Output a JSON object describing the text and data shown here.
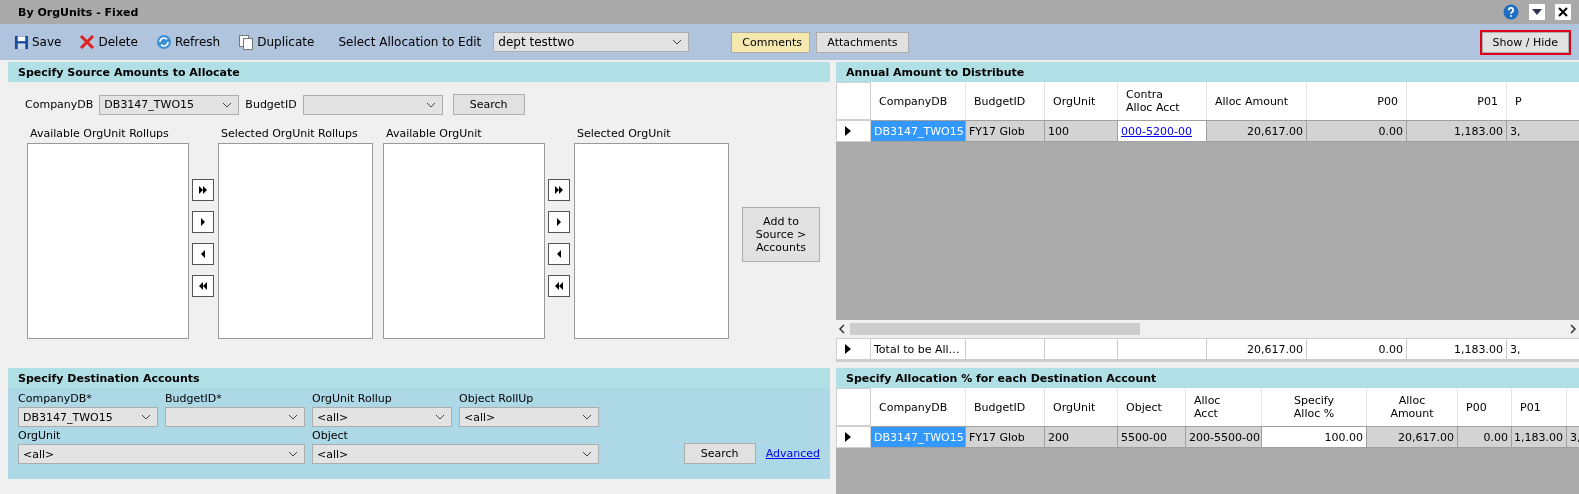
{
  "window": {
    "title": "By OrgUnits - Fixed"
  },
  "toolbar": {
    "buttons": [
      {
        "label": "Save",
        "kind": "save"
      },
      {
        "label": "Delete",
        "kind": "delete"
      },
      {
        "label": "Refresh",
        "kind": "refresh"
      },
      {
        "label": "Duplicate",
        "kind": "duplicate"
      }
    ],
    "allocation_label": "Select Allocation to Edit",
    "allocation_value": "dept testtwo",
    "comments": "Comments",
    "attachments": "Attachments",
    "show_hide": "Show / Hide"
  },
  "source": {
    "title": "Specify Source Amounts to Allocate",
    "company_label": "CompanyDB",
    "company_value": "DB3147_TWO15",
    "budget_label": "BudgetID",
    "search": "Search",
    "lists": [
      "Available OrgUnit Rollups",
      "Selected OrgUnit Rollups",
      "Available OrgUnit",
      "Selected OrgUnit"
    ],
    "add_button": "Add to Source > Accounts"
  },
  "destination": {
    "title": "Specify Destination Accounts",
    "fields": [
      {
        "label": "CompanyDB*",
        "value": "DB3147_TWO15"
      },
      {
        "label": "BudgetID*"
      },
      {
        "label": "OrgUnit Rollup",
        "value": "<all>"
      },
      {
        "label": "Object RollUp",
        "value": "<all>"
      },
      {
        "label": "OrgUnit",
        "value": "<all>"
      },
      {
        "label": "Object",
        "value": "<all>"
      }
    ],
    "search": "Search",
    "advanced": "Advanced"
  },
  "annual_grid": {
    "title": "Annual Amount to Distribute",
    "columns": [
      "CompanyDB",
      "BudgetID",
      "OrgUnit",
      "Contra\nAlloc Acct",
      "Alloc Amount",
      "P00",
      "P01",
      "P"
    ],
    "rows": [
      {
        "cells": [
          {
            "text": "DB3147_TWO15",
            "kind": "current"
          },
          {
            "text": "FY17 Glob",
            "kind": "readonly"
          },
          {
            "text": "100",
            "kind": "readonly"
          },
          {
            "text": "000-5200-00",
            "kind": "link"
          },
          {
            "text": "20,617.00",
            "kind": "readonly_num"
          },
          {
            "text": "0.00",
            "kind": "readonly_num"
          },
          {
            "text": "1,183.00",
            "kind": "readonly_num"
          },
          {
            "text": "3,",
            "kind": "readonly"
          }
        ]
      }
    ],
    "total_row": {
      "label": "Total to be All…",
      "amounts": [
        "20,617.00",
        "0.00",
        "1,183.00",
        "3,"
      ]
    }
  },
  "allocation_grid": {
    "title": "Specify Allocation % for each Destination Account",
    "columns": [
      "CompanyDB",
      "BudgetID",
      "OrgUnit",
      "Object",
      "Alloc\nAcct",
      "Specify\nAlloc %",
      "Alloc\nAmount",
      "P00",
      "P01"
    ],
    "rows": [
      {
        "cells": [
          {
            "text": "DB3147_TWO15",
            "kind": "current"
          },
          {
            "text": "FY17 Glob",
            "kind": "readonly"
          },
          {
            "text": "200",
            "kind": "readonly"
          },
          {
            "text": "5500-00",
            "kind": "readonly"
          },
          {
            "text": "200-5500-00",
            "kind": "readonly"
          },
          {
            "text": "100.00",
            "kind": "edit_num"
          },
          {
            "text": "20,617.00",
            "kind": "readonly_num"
          },
          {
            "text": "0.00",
            "kind": "readonly_num"
          },
          {
            "text": "1,183.00",
            "kind": "readonly_num"
          },
          {
            "text": "3,",
            "kind": "readonly"
          }
        ]
      }
    ]
  }
}
